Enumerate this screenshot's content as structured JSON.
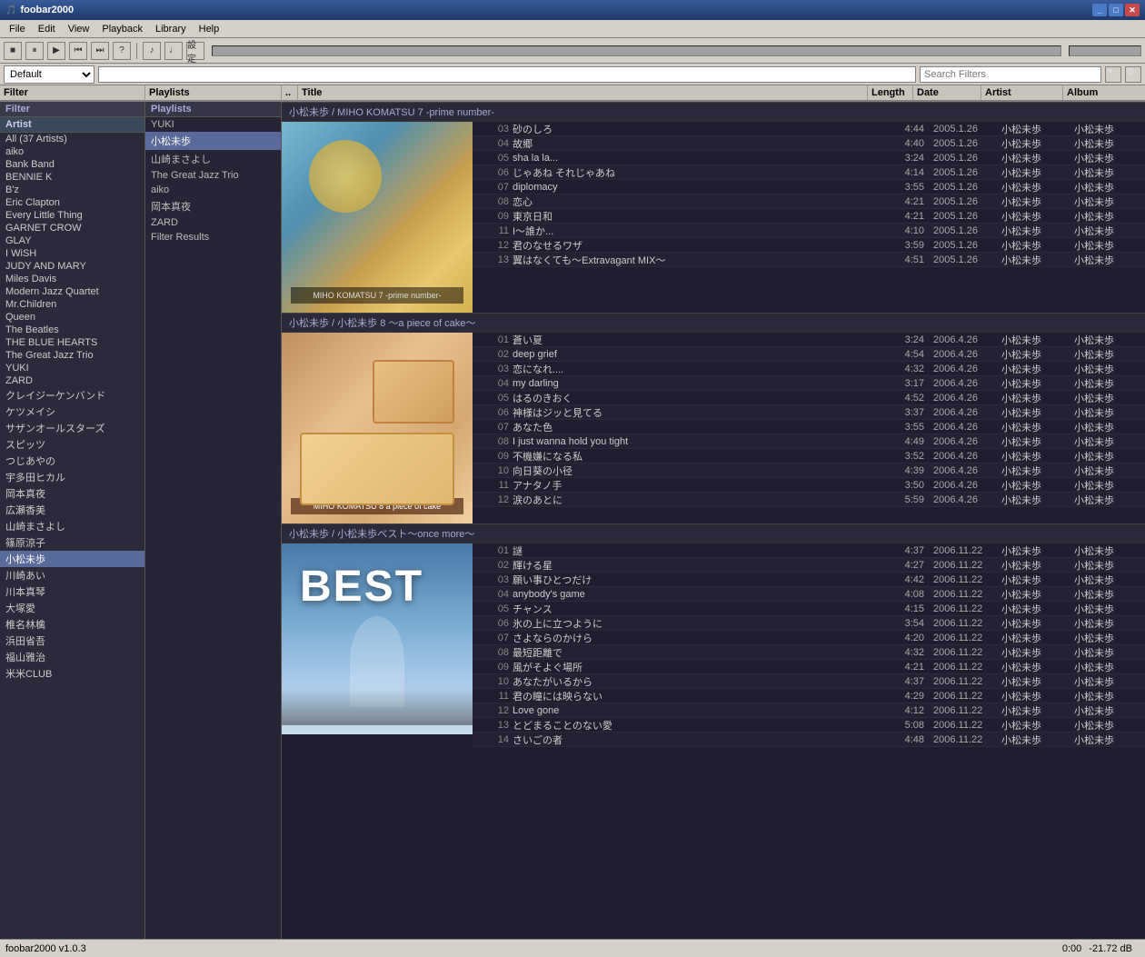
{
  "app": {
    "title": "foobar2000",
    "version": "foobar2000 v1.0.3"
  },
  "menu": {
    "items": [
      "File",
      "Edit",
      "View",
      "Playback",
      "Library",
      "Help"
    ]
  },
  "toolbar": {
    "buttons": [
      "■",
      "⏸",
      "▶",
      "⏮",
      "⏭",
      "?",
      "♪",
      "♩",
      "設定"
    ],
    "volume_label": "設定"
  },
  "filter_bar": {
    "default_label": "Default",
    "search_placeholder": "Search Filters"
  },
  "filter_panel": {
    "label": "Filter",
    "artist_label": "Artist",
    "artists": [
      "All (37 Artists)",
      "aiko",
      "Bank Band",
      "BENNIE K",
      "B'z",
      "Eric Clapton",
      "Every Little Thing",
      "GARNET CROW",
      "GLAY",
      "I WiSH",
      "JUDY AND MARY",
      "Miles Davis",
      "Modern Jazz Quartet",
      "Mr.Children",
      "Queen",
      "The Beatles",
      "THE BLUE HEARTS",
      "The Great Jazz Trio",
      "YUKI",
      "ZARD",
      "クレイジーケンバンド",
      "ケツメイシ",
      "サザンオールスターズ",
      "スピッツ",
      "つじあやの",
      "宇多田ヒカル",
      "岡本真夜",
      "広瀬香美",
      "山崎まさよし",
      "篠原涼子",
      "小松未歩",
      "川崎あい",
      "川本真琴",
      "大塚愛",
      "椎名林檎",
      "浜田省吾",
      "福山雅治",
      "米米CLUB"
    ]
  },
  "playlists": {
    "label": "Playlists",
    "items": [
      "YUKI",
      "小松未歩",
      "山崎まさよし",
      "The Great Jazz Trio",
      "aiko",
      "岡本真夜",
      "ZARD",
      "Filter Results"
    ],
    "selected": "小松未歩"
  },
  "columns": {
    "dot": "..",
    "title": "Title",
    "length": "Length",
    "date": "Date",
    "artist": "Artist",
    "album": "Album"
  },
  "albums": [
    {
      "id": "album1",
      "header": "小松未歩 / MIHO KOMATSU 7 -prime number-",
      "art_type": "carousel",
      "art_text": "MIHO KOMATSU 7 -prime number-",
      "tracks": [
        {
          "num": "03",
          "title": "砂のしろ",
          "length": "4:44",
          "date": "2005.1.26",
          "artist": "小松未歩",
          "album": "小松未歩"
        },
        {
          "num": "04",
          "title": "故郷",
          "length": "4:40",
          "date": "2005.1.26",
          "artist": "小松未歩",
          "album": "小松未歩"
        },
        {
          "num": "05",
          "title": "sha la la...",
          "length": "3:24",
          "date": "2005.1.26",
          "artist": "小松未歩",
          "album": "小松未歩"
        },
        {
          "num": "06",
          "title": "じゃあね それじゃあね",
          "length": "4:14",
          "date": "2005.1.26",
          "artist": "小松未歩",
          "album": "小松未歩"
        },
        {
          "num": "07",
          "title": "diplomacy",
          "length": "3:55",
          "date": "2005.1.26",
          "artist": "小松未歩",
          "album": "小松未歩"
        },
        {
          "num": "08",
          "title": "恋心",
          "length": "4:21",
          "date": "2005.1.26",
          "artist": "小松未歩",
          "album": "小松未歩"
        },
        {
          "num": "09",
          "title": "東京日和",
          "length": "4:21",
          "date": "2005.1.26",
          "artist": "小松未歩",
          "album": "小松未歩"
        },
        {
          "num": "11",
          "title": "I～誰か...",
          "length": "4:10",
          "date": "2005.1.26",
          "artist": "小松未歩",
          "album": "小松未歩"
        },
        {
          "num": "12",
          "title": "君のなせるワザ",
          "length": "3:59",
          "date": "2005.1.26",
          "artist": "小松未歩",
          "album": "小松未歩"
        },
        {
          "num": "13",
          "title": "翼はなくても～Extravagant MIX～",
          "length": "4:51",
          "date": "2005.1.26",
          "artist": "小松未歩",
          "album": "小松未歩"
        }
      ]
    },
    {
      "id": "album2",
      "header": "小松未歩 / 小松未歩 8 ～a piece of cake～",
      "art_type": "cake",
      "art_text": "MIHO KOMATSU 8 a piece of cake",
      "tracks": [
        {
          "num": "01",
          "title": "蒼い夏",
          "length": "3:24",
          "date": "2006.4.26",
          "artist": "小松未歩",
          "album": "小松未歩"
        },
        {
          "num": "02",
          "title": "deep grief",
          "length": "4:54",
          "date": "2006.4.26",
          "artist": "小松未歩",
          "album": "小松未歩"
        },
        {
          "num": "03",
          "title": "恋になれ....",
          "length": "4:32",
          "date": "2006.4.26",
          "artist": "小松未歩",
          "album": "小松未歩"
        },
        {
          "num": "04",
          "title": "my darling",
          "length": "3:17",
          "date": "2006.4.26",
          "artist": "小松未歩",
          "album": "小松未歩"
        },
        {
          "num": "05",
          "title": "はるのきおく",
          "length": "4:52",
          "date": "2006.4.26",
          "artist": "小松未歩",
          "album": "小松未歩"
        },
        {
          "num": "06",
          "title": "神様はジッと見てる",
          "length": "3:37",
          "date": "2006.4.26",
          "artist": "小松未歩",
          "album": "小松未歩"
        },
        {
          "num": "07",
          "title": "あなた色",
          "length": "3:55",
          "date": "2006.4.26",
          "artist": "小松未歩",
          "album": "小松未歩"
        },
        {
          "num": "08",
          "title": "I just wanna hold you tight",
          "length": "4:49",
          "date": "2006.4.26",
          "artist": "小松未歩",
          "album": "小松未歩"
        },
        {
          "num": "09",
          "title": "不機嫌になる私",
          "length": "3:52",
          "date": "2006.4.26",
          "artist": "小松未歩",
          "album": "小松未歩"
        },
        {
          "num": "10",
          "title": "向日葵の小径",
          "length": "4:39",
          "date": "2006.4.26",
          "artist": "小松未歩",
          "album": "小松未歩"
        },
        {
          "num": "11",
          "title": "アナタノ手",
          "length": "3:50",
          "date": "2006.4.26",
          "artist": "小松未歩",
          "album": "小松未歩"
        },
        {
          "num": "12",
          "title": "涙のあとに",
          "length": "5:59",
          "date": "2006.4.26",
          "artist": "小松未歩",
          "album": "小松未歩"
        }
      ]
    },
    {
      "id": "album3",
      "header": "小松未歩 / 小松未歩ベスト～once more～",
      "art_type": "best",
      "art_text": "BEST",
      "tracks": [
        {
          "num": "01",
          "title": "謎",
          "length": "4:37",
          "date": "2006.11.22",
          "artist": "小松未歩",
          "album": "小松未歩"
        },
        {
          "num": "02",
          "title": "輝ける星",
          "length": "4:27",
          "date": "2006.11.22",
          "artist": "小松未歩",
          "album": "小松未歩"
        },
        {
          "num": "03",
          "title": "願い事ひとつだけ",
          "length": "4:42",
          "date": "2006.11.22",
          "artist": "小松未歩",
          "album": "小松未歩"
        },
        {
          "num": "04",
          "title": "anybody's game",
          "length": "4:08",
          "date": "2006.11.22",
          "artist": "小松未歩",
          "album": "小松未歩"
        },
        {
          "num": "05",
          "title": "チャンス",
          "length": "4:15",
          "date": "2006.11.22",
          "artist": "小松未歩",
          "album": "小松未歩"
        },
        {
          "num": "06",
          "title": "氷の上に立つように",
          "length": "3:54",
          "date": "2006.11.22",
          "artist": "小松未歩",
          "album": "小松未歩"
        },
        {
          "num": "07",
          "title": "さよならのかけら",
          "length": "4:20",
          "date": "2006.11.22",
          "artist": "小松未歩",
          "album": "小松未歩"
        },
        {
          "num": "08",
          "title": "最短距離で",
          "length": "4:32",
          "date": "2006.11.22",
          "artist": "小松未歩",
          "album": "小松未歩"
        },
        {
          "num": "09",
          "title": "風がそよぐ場所",
          "length": "4:21",
          "date": "2006.11.22",
          "artist": "小松未歩",
          "album": "小松未歩"
        },
        {
          "num": "10",
          "title": "あなたがいるから",
          "length": "4:37",
          "date": "2006.11.22",
          "artist": "小松未歩",
          "album": "小松未歩"
        },
        {
          "num": "11",
          "title": "君の瞳には映らない",
          "length": "4:29",
          "date": "2006.11.22",
          "artist": "小松未歩",
          "album": "小松未歩"
        },
        {
          "num": "12",
          "title": "Love gone",
          "length": "4:12",
          "date": "2006.11.22",
          "artist": "小松未歩",
          "album": "小松未歩"
        },
        {
          "num": "13",
          "title": "とどまることのない愛",
          "length": "5:08",
          "date": "2006.11.22",
          "artist": "小松未歩",
          "album": "小松未歩"
        },
        {
          "num": "14",
          "title": "さいごの者",
          "length": "4:48",
          "date": "2006.11.22",
          "artist": "小松未歩",
          "album": "小松未歩"
        }
      ]
    }
  ],
  "status": {
    "version": "foobar2000 v1.0.3",
    "time": "0:00",
    "db": "-21.72 dB"
  }
}
